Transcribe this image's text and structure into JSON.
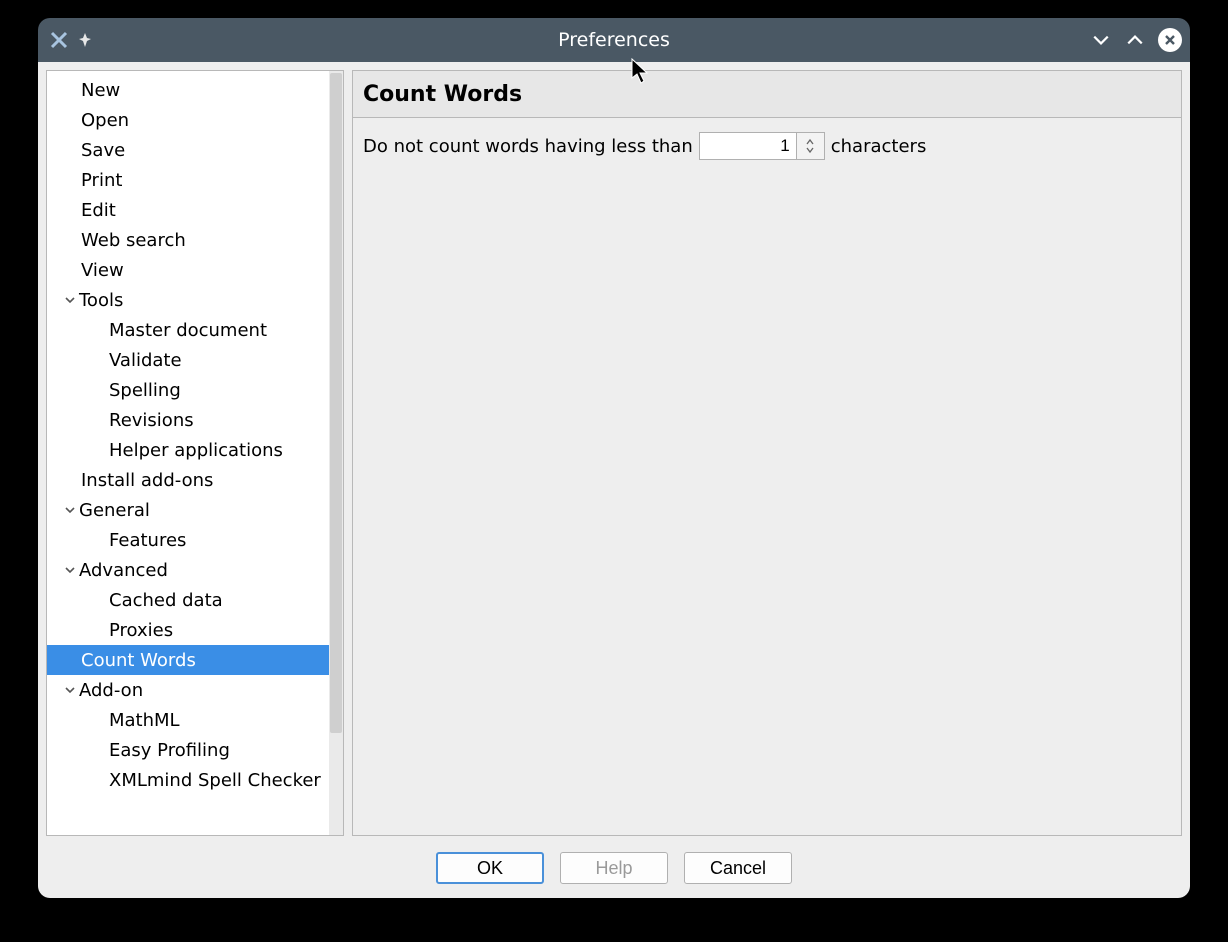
{
  "window": {
    "title": "Preferences"
  },
  "tree": [
    {
      "label": "New",
      "indent": 34,
      "twist": false
    },
    {
      "label": "Open",
      "indent": 34,
      "twist": false
    },
    {
      "label": "Save",
      "indent": 34,
      "twist": false
    },
    {
      "label": "Print",
      "indent": 34,
      "twist": false
    },
    {
      "label": "Edit",
      "indent": 34,
      "twist": false
    },
    {
      "label": "Web search",
      "indent": 34,
      "twist": false
    },
    {
      "label": "View",
      "indent": 34,
      "twist": false
    },
    {
      "label": "Tools",
      "indent": 34,
      "twist": true
    },
    {
      "label": "Master document",
      "indent": 62,
      "twist": false
    },
    {
      "label": "Validate",
      "indent": 62,
      "twist": false
    },
    {
      "label": "Spelling",
      "indent": 62,
      "twist": false
    },
    {
      "label": "Revisions",
      "indent": 62,
      "twist": false
    },
    {
      "label": "Helper applications",
      "indent": 62,
      "twist": false
    },
    {
      "label": "Install add-ons",
      "indent": 34,
      "twist": false
    },
    {
      "label": "General",
      "indent": 34,
      "twist": true
    },
    {
      "label": "Features",
      "indent": 62,
      "twist": false
    },
    {
      "label": "Advanced",
      "indent": 34,
      "twist": true
    },
    {
      "label": "Cached data",
      "indent": 62,
      "twist": false
    },
    {
      "label": "Proxies",
      "indent": 62,
      "twist": false
    },
    {
      "label": "Count Words",
      "indent": 34,
      "twist": false,
      "selected": true
    },
    {
      "label": "Add-on",
      "indent": 34,
      "twist": true
    },
    {
      "label": "MathML",
      "indent": 62,
      "twist": false
    },
    {
      "label": "Easy Profiling",
      "indent": 62,
      "twist": false
    },
    {
      "label": "XMLmind Spell Checker",
      "indent": 62,
      "twist": false
    }
  ],
  "panel": {
    "title": "Count Words",
    "label_before": "Do not count words having less than",
    "value": "1",
    "label_after": "characters"
  },
  "buttons": {
    "ok": "OK",
    "help": "Help",
    "cancel": "Cancel"
  }
}
